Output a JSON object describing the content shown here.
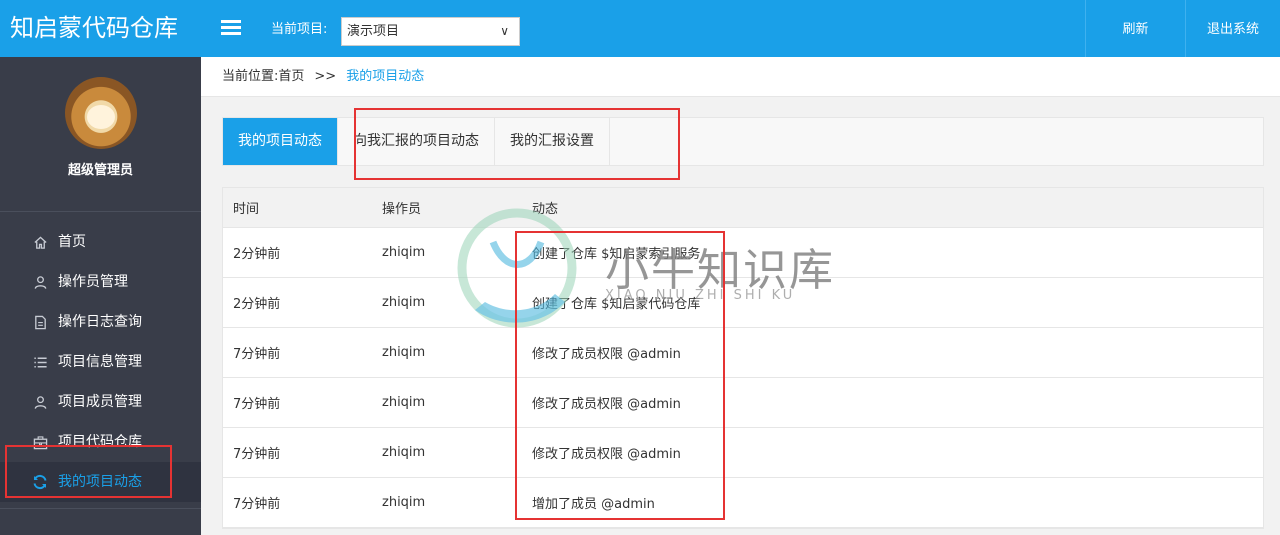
{
  "app": {
    "brand": "知启蒙代码仓库",
    "user": {
      "name": "超级管理员"
    }
  },
  "sidebar": {
    "items": [
      {
        "label": "首页",
        "icon": "home-icon"
      },
      {
        "label": "操作员管理",
        "icon": "user-icon"
      },
      {
        "label": "操作日志查询",
        "icon": "document-icon"
      },
      {
        "label": "项目信息管理",
        "icon": "list-icon"
      },
      {
        "label": "项目成员管理",
        "icon": "user-icon"
      },
      {
        "label": "项目代码仓库",
        "icon": "briefcase-icon"
      },
      {
        "label": "我的项目动态",
        "icon": "refresh-icon",
        "active": true
      }
    ]
  },
  "topbar": {
    "project_label": "当前项目:",
    "project_value": "演示项目",
    "refresh": "刷新",
    "logout": "退出系统"
  },
  "breadcrumb": {
    "prefix": "当前位置:",
    "home": "首页",
    "separator": ">>",
    "current": "我的项目动态"
  },
  "tabs": [
    {
      "label": "我的项目动态",
      "active": true
    },
    {
      "label": "向我汇报的项目动态",
      "active": false
    },
    {
      "label": "我的汇报设置",
      "active": false
    }
  ],
  "table": {
    "headers": [
      "时间",
      "操作员",
      "动态"
    ],
    "rows": [
      [
        "2分钟前",
        "zhiqim",
        "创建了仓库 $知启蒙索引服务"
      ],
      [
        "2分钟前",
        "zhiqim",
        "创建了仓库 $知启蒙代码仓库"
      ],
      [
        "7分钟前",
        "zhiqim",
        "修改了成员权限 @admin"
      ],
      [
        "7分钟前",
        "zhiqim",
        "修改了成员权限 @admin"
      ],
      [
        "7分钟前",
        "zhiqim",
        "修改了成员权限 @admin"
      ],
      [
        "7分钟前",
        "zhiqim",
        "增加了成员 @admin"
      ]
    ]
  },
  "watermark": {
    "main": "小牛知识库",
    "sub": "XIAO NIU ZHI SHI KU"
  },
  "colors": {
    "primary": "#1aa0e8",
    "sidebar": "#393d49",
    "highlight": "#e53333"
  }
}
